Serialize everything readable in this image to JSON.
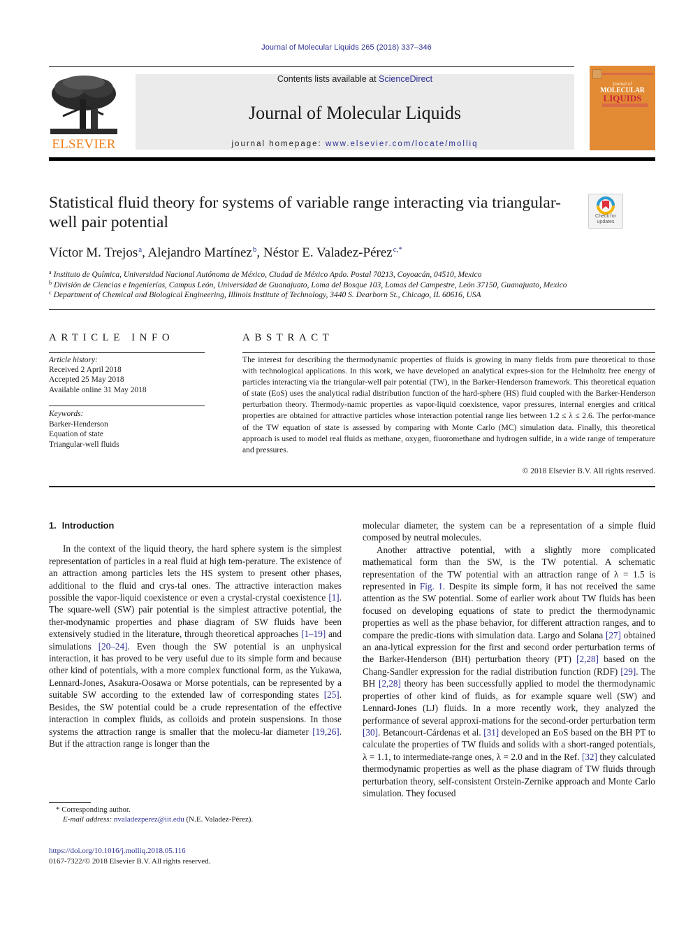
{
  "running_head": "Journal of Molecular Liquids 265 (2018) 337–346",
  "masthead": {
    "publisher": "ELSEVIER",
    "contents_prefix": "Contents lists available at ",
    "contents_link": "ScienceDirect",
    "journal_title": "Journal of Molecular Liquids",
    "homepage_prefix": "journal homepage: ",
    "homepage_link": "www.elsevier.com/locate/molliq",
    "cover": {
      "line1": "journal of",
      "line2": "MOLECULAR",
      "line3": "LIQUIDS",
      "color": "#e38a34"
    },
    "publisher_color": "#f07f1a",
    "link_color": "#2e3192"
  },
  "check_updates": {
    "label_line1": "Check for",
    "label_line2": "updates",
    "icon": "check-for-updates-icon"
  },
  "title": "Statistical fluid theory for systems of variable range interacting via triangular-well pair potential",
  "authors": [
    {
      "name": "Víctor M. Trejos",
      "affil": "a"
    },
    {
      "name": "Alejandro Martínez",
      "affil": "b"
    },
    {
      "name": "Néstor E. Valadez-Pérez",
      "affil": "c,*"
    }
  ],
  "affiliations": [
    {
      "mark": "a",
      "text": "Instituto de Química, Universidad Nacional Autónoma de México, Ciudad de México Apdo. Postal 70213, Coyoacán, 04510, Mexico"
    },
    {
      "mark": "b",
      "text": "División de Ciencias e Ingenierías, Campus León, Universidad de Guanajuato, Loma del Bosque 103, Lomas del Campestre, León 37150, Guanajuato, Mexico"
    },
    {
      "mark": "c",
      "text": "Department of Chemical and Biological Engineering, Illinois Institute of Technology, 3440 S. Dearborn St., Chicago, IL 60616, USA"
    }
  ],
  "article_info": {
    "heading": "ARTICLE INFO",
    "history_label": "Article history:",
    "history": [
      "Received 2 April 2018",
      "Accepted 25 May 2018",
      "Available online 31 May 2018"
    ],
    "keywords_label": "Keywords:",
    "keywords": [
      "Barker-Henderson",
      "Equation of state",
      "Triangular-well fluids"
    ]
  },
  "abstract": {
    "heading": "ABSTRACT",
    "text": "The interest for describing the thermodynamic properties of fluids is growing in many fields from pure theoretical to those with technological applications. In this work, we have developed an analytical expres-sion for the Helmholtz free energy of particles interacting via the triangular-well pair potential (TW), in the Barker-Henderson framework. This theoretical equation of state (EoS) uses the analytical radial distribution function of the hard-sphere (HS) fluid coupled with the Barker-Henderson perturbation theory. Thermody-namic properties as vapor-liquid coexistence, vapor pressures, internal energies and critical properties are obtained for attractive particles whose interaction potential range lies between 1.2 ≤ λ ≤ 2.6. The perfor-mance of the TW equation of state is assessed by comparing with Monte Carlo (MC) simulation data. Finally, this theoretical approach is used to model real fluids as methane, oxygen, fluoromethane and hydrogen sulfide, in a wide range of temperature and pressures.",
    "copyright": "© 2018 Elsevier B.V. All rights reserved."
  },
  "section": {
    "number": "1.",
    "title": "Introduction"
  },
  "body": {
    "left_p1": [
      {
        "t": "In the context of the liquid theory, the hard sphere system is the simplest representation of particles in a real fluid at high tem-perature. The existence of an attraction among particles lets the HS system to present other phases, additional to the fluid and crys-tal ones. The attractive interaction makes possible the vapor-liquid coexistence or even a crystal-crystal coexistence "
      },
      {
        "ref": "[1]"
      },
      {
        "t": ". The square-well (SW) pair potential is the simplest attractive potential, the ther-modynamic properties and phase diagram of SW fluids have been extensively studied in the literature, through theoretical approaches "
      },
      {
        "ref": "[1–19]"
      },
      {
        "t": " and simulations "
      },
      {
        "ref": "[20–24]"
      },
      {
        "t": ". Even though the SW potential is an unphysical interaction, it has proved to be very useful due to its simple form and because other kind of potentials, with a more complex functional form, as the Yukawa, Lennard-Jones, Asakura-Oosawa or Morse potentials, can be represented by a suitable SW according to the extended law of corresponding states "
      },
      {
        "ref": "[25]"
      },
      {
        "t": ". Besides, the SW potential could be a crude representation of the effective interaction in complex fluids, as colloids and protein suspensions. In those systems the attraction range is smaller that the molecu-lar diameter "
      },
      {
        "ref": "[19,26]"
      },
      {
        "t": ". But if the attraction range is longer than the"
      }
    ],
    "right_p1": [
      {
        "t": "molecular diameter, the system can be a representation of a simple fluid composed by neutral molecules."
      }
    ],
    "right_p2": [
      {
        "t": "Another attractive potential, with a slightly more complicated mathematical form than the SW, is the TW potential. A schematic representation of the TW potential with an attraction range of λ = 1.5 is represented in "
      },
      {
        "ref": "Fig. 1"
      },
      {
        "t": ". Despite its simple form, it has not received the same attention as the SW potential. Some of earlier work about TW fluids has been focused on developing equations of state to predict the thermodynamic properties as well as the phase behavior, for different attraction ranges, and to compare the predic-tions with simulation data. Largo and Solana "
      },
      {
        "ref": "[27]"
      },
      {
        "t": " obtained an ana-lytical expression for the first and second order perturbation terms of the Barker-Henderson (BH) perturbation theory (PT) "
      },
      {
        "ref": "[2,28]"
      },
      {
        "t": " based on the Chang-Sandler expression for the radial distribution function (RDF) "
      },
      {
        "ref": "[29]"
      },
      {
        "t": ". The BH "
      },
      {
        "ref": "[2,28]"
      },
      {
        "t": " theory has been successfully applied to model the thermodynamic properties of other kind of fluids, as for example square well (SW) and Lennard-Jones (LJ) fluids. In a more recently work, they analyzed the performance of several approxi-mations for the second-order perturbation term "
      },
      {
        "ref": "[30]"
      },
      {
        "t": ". Betancourt-Cárdenas et al. "
      },
      {
        "ref": "[31]"
      },
      {
        "t": " developed an EoS based on the BH PT to calculate the properties of TW fluids and solids with a short-ranged potentials, λ = 1.1, to intermediate-range ones, λ = 2.0 and in the Ref. "
      },
      {
        "ref": "[32]"
      },
      {
        "t": " they calculated thermodynamic properties as well as the phase diagram of TW fluids through perturbation theory, self-consistent Orstein-Zernike approach and Monte Carlo simulation. They focused"
      }
    ]
  },
  "footnote": {
    "mark": "*",
    "corresponding": "Corresponding author.",
    "email_label": "E-mail address: ",
    "email": "nvaladezperez@iit.edu",
    "email_owner": " (N.E. Valadez-Pérez)."
  },
  "doi": "https://doi.org/10.1016/j.molliq.2018.05.116",
  "issn_copyright": "0167-7322/© 2018 Elsevier B.V. All rights reserved."
}
